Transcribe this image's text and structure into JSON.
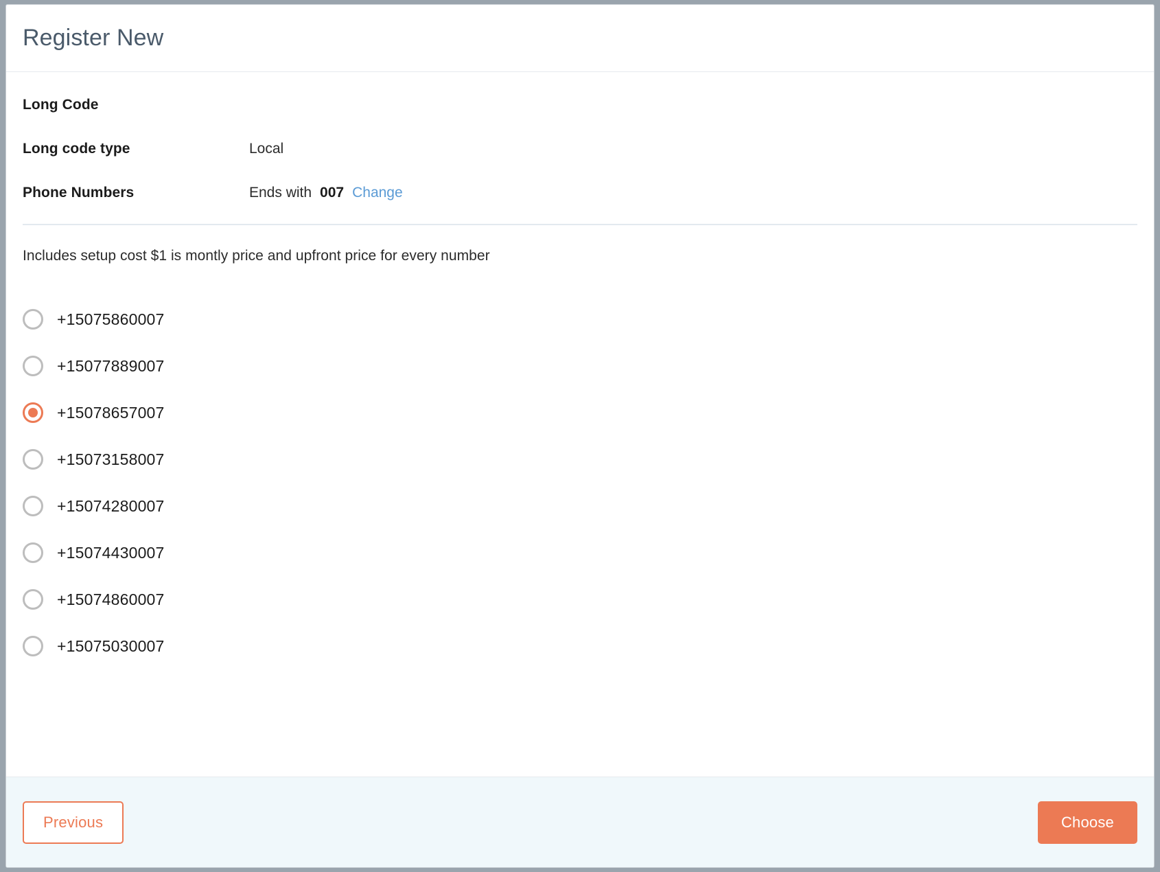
{
  "header": {
    "title": "Register New"
  },
  "summary": {
    "rows": [
      {
        "label": "Long Code",
        "value": "",
        "suffix": "",
        "link": ""
      },
      {
        "label": "Long code type",
        "value": "Local",
        "suffix": "",
        "link": ""
      },
      {
        "label": "Phone Numbers",
        "value": "Ends with",
        "suffix": "007",
        "link": "Change"
      }
    ]
  },
  "note": "Includes setup cost $1 is montly price and upfront price for every number",
  "numbers": {
    "selected_index": 2,
    "options": [
      {
        "value": "+15075860007"
      },
      {
        "value": "+15077889007"
      },
      {
        "value": "+15078657007"
      },
      {
        "value": "+15073158007"
      },
      {
        "value": "+15074280007"
      },
      {
        "value": "+15074430007"
      },
      {
        "value": "+15074860007"
      },
      {
        "value": "+15075030007"
      }
    ]
  },
  "footer": {
    "previous_label": "Previous",
    "choose_label": "Choose"
  },
  "colors": {
    "accent": "#ec7a54",
    "link": "#5b9bd5",
    "title": "#4a5a6a",
    "footer_bg": "#f0f8fb"
  }
}
